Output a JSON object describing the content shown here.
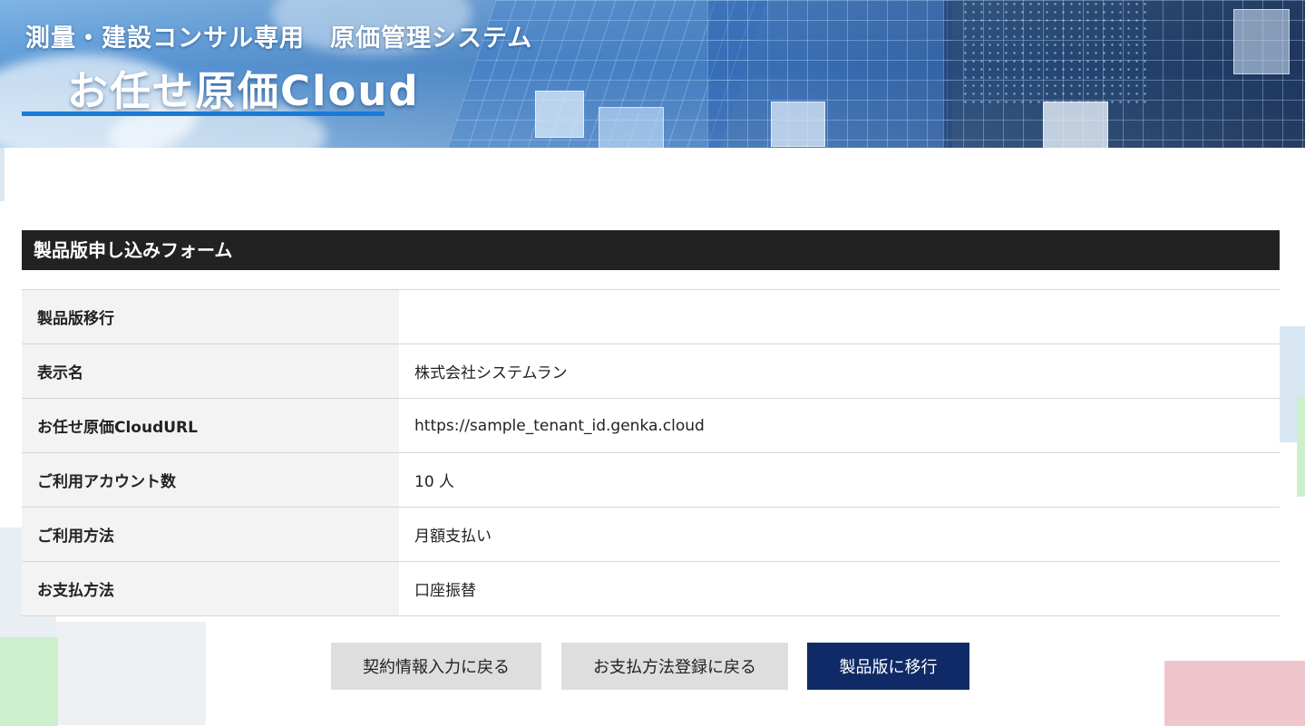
{
  "banner": {
    "subtitle": "測量・建設コンサル専用　原価管理システム",
    "title": "お任せ原価Cloud"
  },
  "form": {
    "title": "製品版申し込みフォーム",
    "rows": [
      {
        "label": "製品版移行",
        "value": ""
      },
      {
        "label": "表示名",
        "value": "株式会社システムラン"
      },
      {
        "label": "お任せ原価CloudURL",
        "value": "https://sample_tenant_id.genka.cloud"
      },
      {
        "label": "ご利用アカウント数",
        "value": "10 人"
      },
      {
        "label": "ご利用方法",
        "value": "月額支払い"
      },
      {
        "label": "お支払方法",
        "value": "口座振替"
      }
    ]
  },
  "buttons": {
    "back_contract": "契約情報入力に戻る",
    "back_payment": "お支払方法登録に戻る",
    "migrate": "製品版に移行"
  },
  "colors": {
    "header_bg": "#222222",
    "primary_button": "#0f2a66",
    "secondary_button": "#dedede",
    "banner_accent": "#1b7ad6"
  }
}
